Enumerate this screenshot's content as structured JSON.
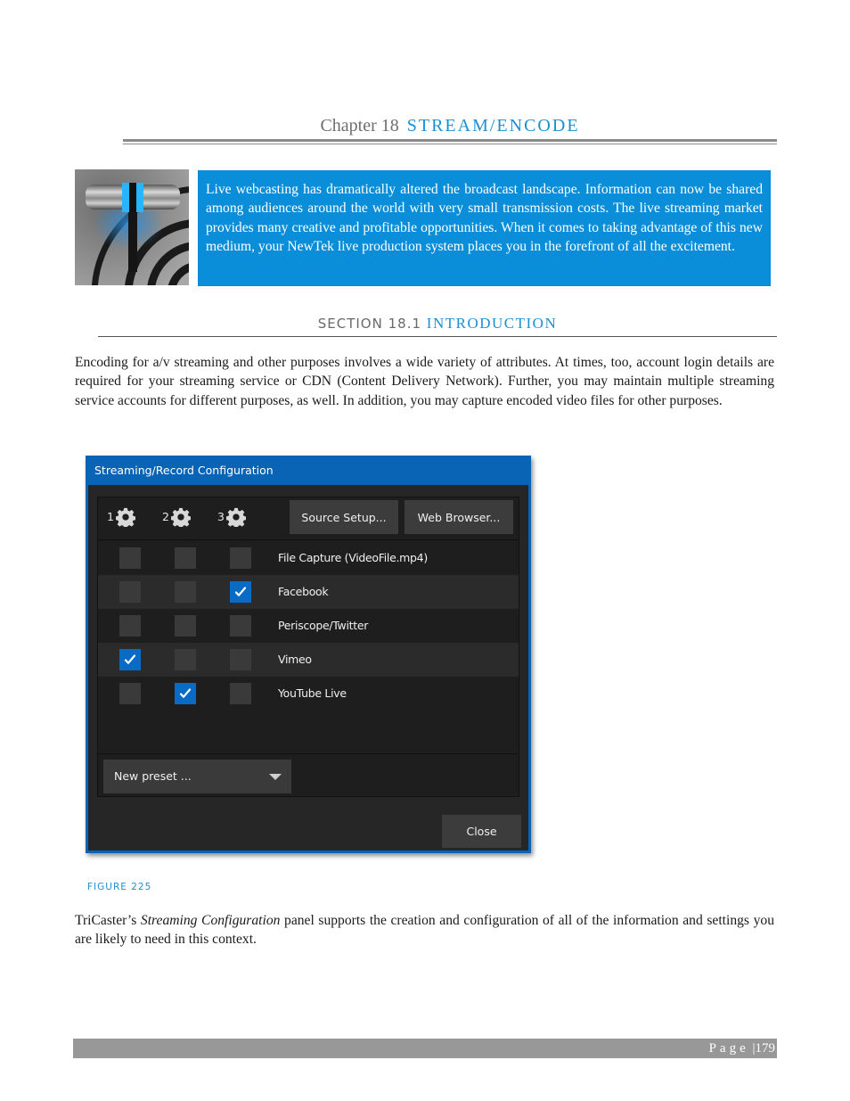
{
  "chapter": {
    "prefix": "Chapter 18",
    "title": "STREAM/ENCODE"
  },
  "intro_box": {
    "icon": "tbar-fader-icon",
    "text": "Live webcasting has dramatically altered the broadcast landscape. Information can now be shared among audiences around the world with very small transmission costs. The live streaming market provides many creative and profitable opportunities.  When it comes to taking advantage of this new medium, your NewTek live production system places you in the forefront of all the excitement."
  },
  "section": {
    "prefix": "SECTION 18.1",
    "title": "INTRODUCTION"
  },
  "paragraphs": {
    "p1": "Encoding for a/v streaming and other purposes involves a wide variety of attributes. At times, too, account login details are required for your streaming service or CDN (Content Delivery Network). Further, you may maintain multiple streaming service accounts for different purposes, as well.  In addition, you may capture encoded video files for other purposes.",
    "p2_before": "TriCaster’s ",
    "p2_italic": "Streaming Configuration",
    "p2_after": " panel supports the creation and configuration of all of the information and settings you are likely to need in this context."
  },
  "dialog": {
    "title": "Streaming/Record Configuration",
    "encoders": [
      {
        "label": "1",
        "icon": "gear-icon"
      },
      {
        "label": "2",
        "icon": "gear-icon"
      },
      {
        "label": "3",
        "icon": "gear-icon"
      }
    ],
    "source_setup_label": "Source Setup...",
    "web_browser_label": "Web Browser...",
    "destinations": [
      {
        "name": "File Capture (VideoFile.mp4)",
        "checks": [
          false,
          false,
          false
        ]
      },
      {
        "name": "Facebook",
        "checks": [
          false,
          false,
          true
        ]
      },
      {
        "name": "Periscope/Twitter",
        "checks": [
          false,
          false,
          false
        ]
      },
      {
        "name": "Vimeo",
        "checks": [
          true,
          false,
          false
        ]
      },
      {
        "name": "YouTube Live",
        "checks": [
          false,
          true,
          false
        ]
      }
    ],
    "preset_value": "New preset ...",
    "close_label": "Close",
    "accent_color": "#0a6bc4"
  },
  "figure_caption": "FIGURE 225",
  "footer": {
    "page_word": "Page",
    "separator": "|",
    "page_number": "179"
  }
}
